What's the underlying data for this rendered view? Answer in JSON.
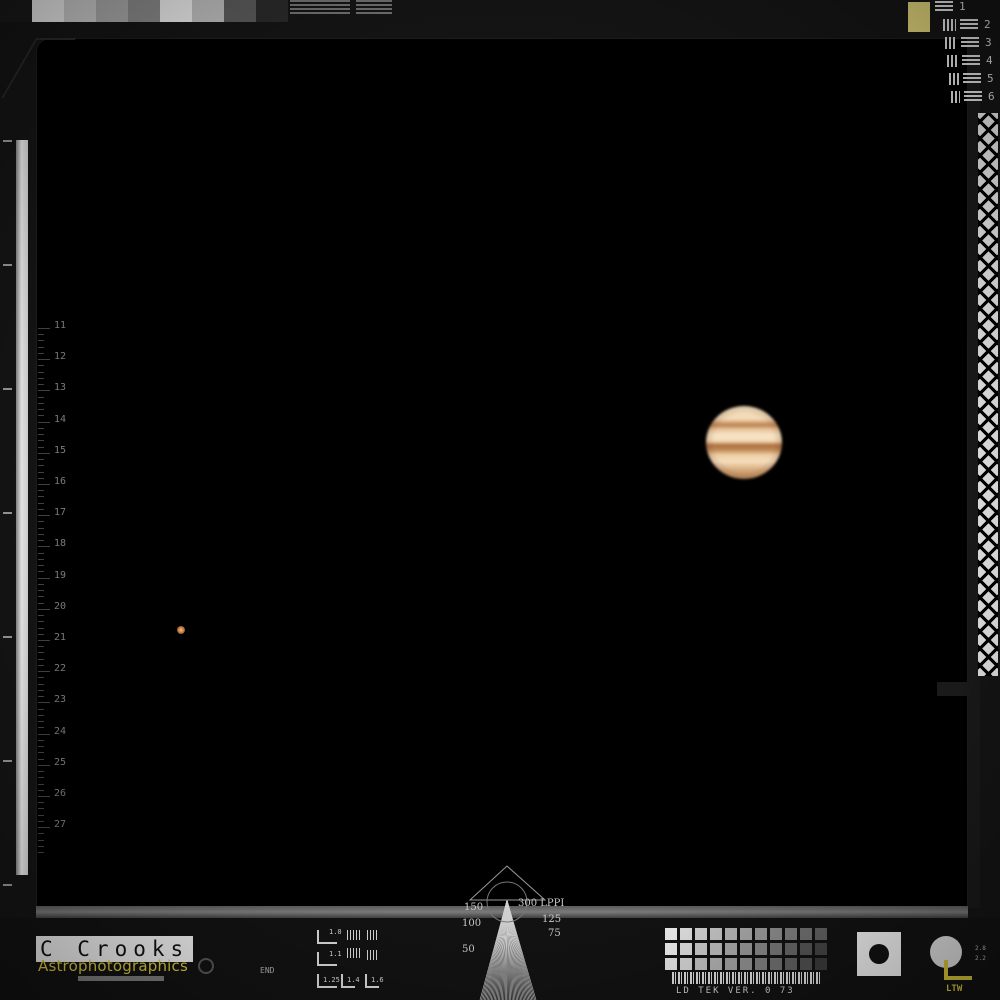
{
  "scale": {
    "numbers": [
      "11",
      "12",
      "13",
      "14",
      "15",
      "16",
      "17",
      "18",
      "19",
      "20",
      "21",
      "22",
      "23",
      "24",
      "25",
      "26",
      "27"
    ]
  },
  "resolution_chart": {
    "rows": [
      "1",
      "2",
      "3",
      "4",
      "5",
      "6"
    ]
  },
  "fan": {
    "labels": [
      "150",
      "300 LPPI",
      "125",
      "100",
      "75",
      "50"
    ]
  },
  "logo": {
    "name": "C Crooks",
    "subtitle": "Astrophotographics"
  },
  "test_target": {
    "labels": [
      "1.0",
      "1.1",
      "1.25",
      "1.4",
      "1.6"
    ]
  },
  "end_label": "END",
  "version_label": "LD TEK VER. 0 73",
  "corner_label": "LTW",
  "corner_numbers": [
    "2.8",
    "2.2"
  ],
  "colors": {
    "accent_yellow": "#d6c43a",
    "sky": "#000000",
    "frame": "#151515"
  },
  "grayscale_steps": [
    "#1a1a1a",
    "#e8e8e8",
    "#c8c8c8",
    "#a8a8a8",
    "#888888",
    "#e8e8e8",
    "#bcbcbc",
    "#5a5a5a",
    "#2a2a2a"
  ],
  "gray_grid_shades": [
    "#eeeeee",
    "#e0e0e0",
    "#d2d2d2",
    "#c4c4c4",
    "#b6b6b6",
    "#a8a8a8",
    "#9a9a9a",
    "#8c8c8c",
    "#7e7e7e",
    "#707070",
    "#606060",
    "#eeeeee",
    "#dddddd",
    "#cccccc",
    "#bbbbbb",
    "#aaaaaa",
    "#999999",
    "#888888",
    "#777777",
    "#666666",
    "#555555",
    "#444444",
    "#e4e4e4",
    "#d4d4d4",
    "#c0c0c0",
    "#b0b0b0",
    "#a0a0a0",
    "#909090",
    "#808080",
    "#707070",
    "#606060",
    "#505050",
    "#3a3a3a"
  ]
}
